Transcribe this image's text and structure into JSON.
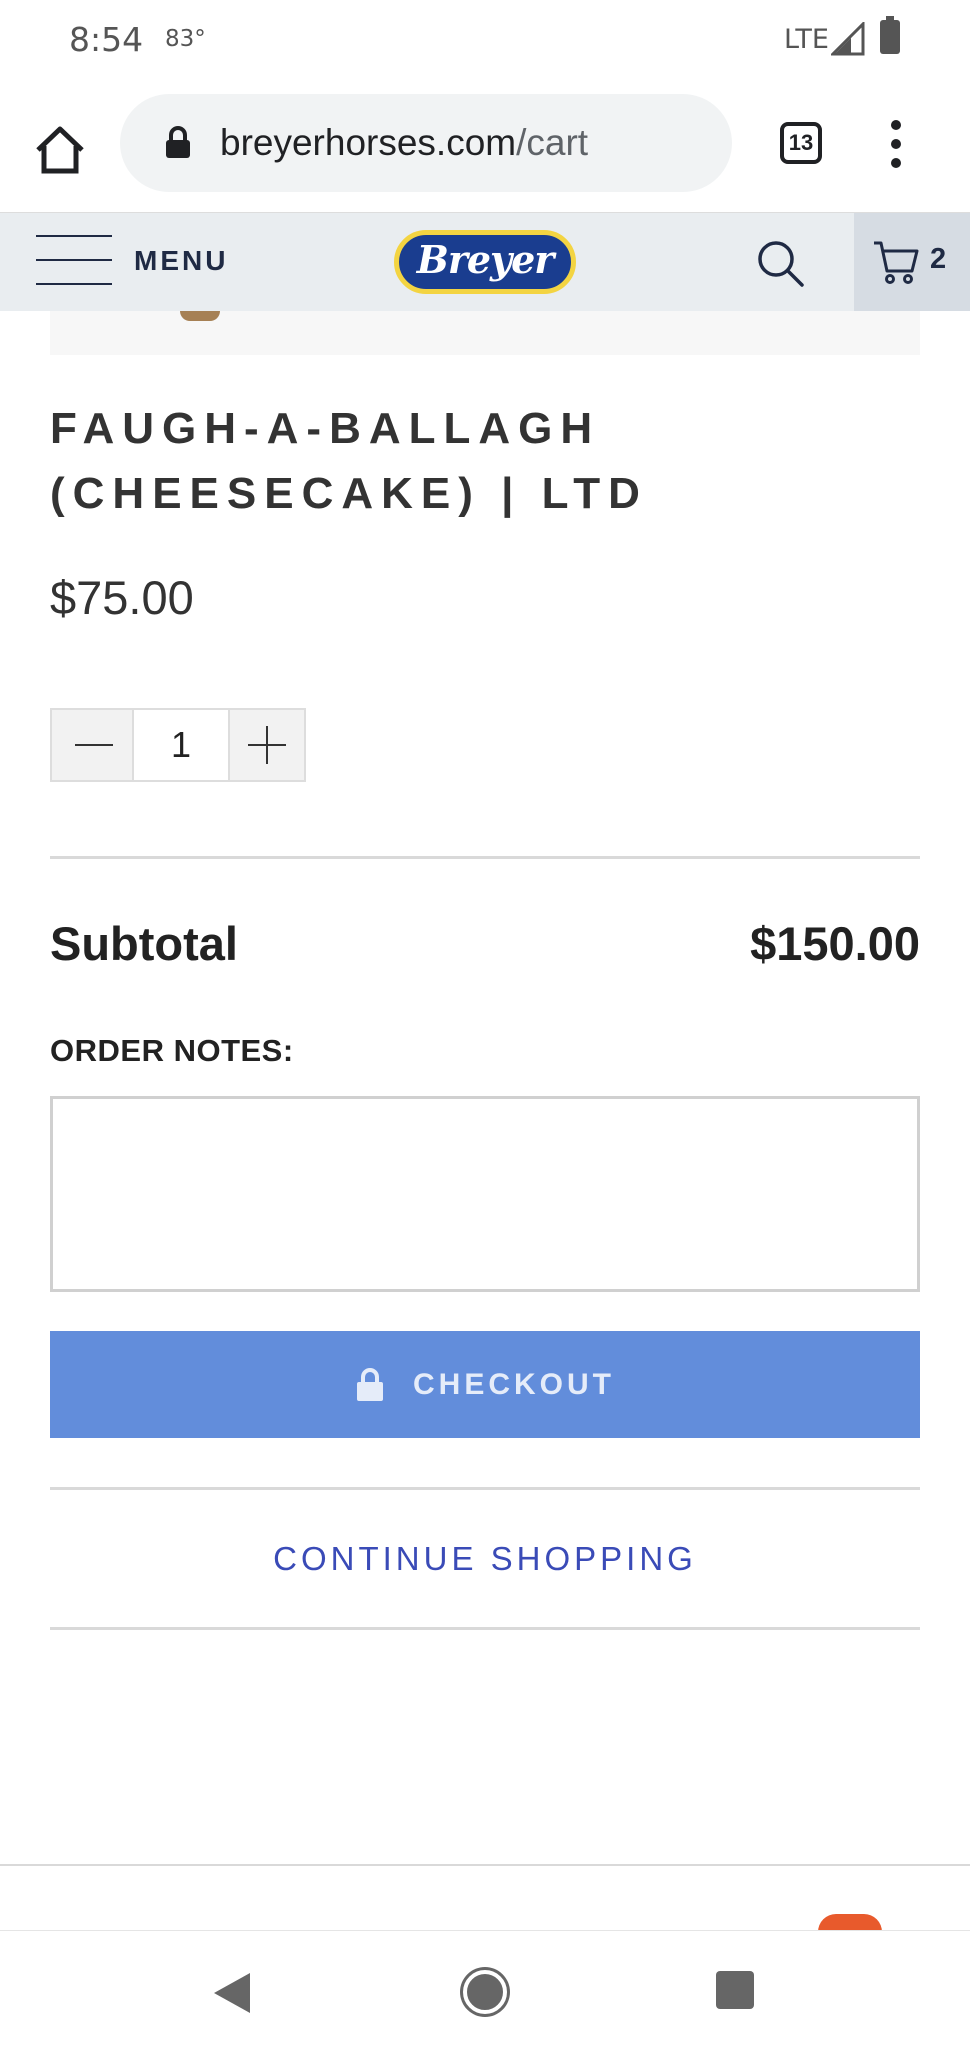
{
  "status_bar": {
    "time": "8:54",
    "temperature": "83°",
    "network": "LTE"
  },
  "browser": {
    "url_host": "breyerhorses.com",
    "url_path": "/cart",
    "tab_count": "13"
  },
  "header": {
    "menu_label": "MENU",
    "logo_text": "Breyer",
    "cart_count": "2"
  },
  "product": {
    "title": "FAUGH-A-BALLAGH (CHEESECAKE) | LTD",
    "price": "$75.00",
    "quantity": "1"
  },
  "cart": {
    "subtotal_label": "Subtotal",
    "subtotal_value": "$150.00",
    "order_notes_label": "ORDER NOTES:",
    "order_notes_value": "",
    "checkout_label": "CHECKOUT",
    "continue_label": "CONTINUE SHOPPING"
  },
  "colors": {
    "checkout_button": "#628ddb",
    "link": "#3a4bb7",
    "header_bg": "#e9edf0",
    "logo_blue": "#1a3d8f",
    "logo_yellow": "#f3d442"
  },
  "icons": {
    "status": [
      "signal-icon",
      "battery-icon"
    ],
    "browser": [
      "home-icon",
      "lock-icon",
      "tabs-icon",
      "more-vert-icon"
    ],
    "header": [
      "hamburger-icon",
      "search-icon",
      "cart-icon"
    ],
    "checkout": "lock-icon",
    "nav": [
      "back-icon",
      "home-icon",
      "recents-icon"
    ]
  }
}
